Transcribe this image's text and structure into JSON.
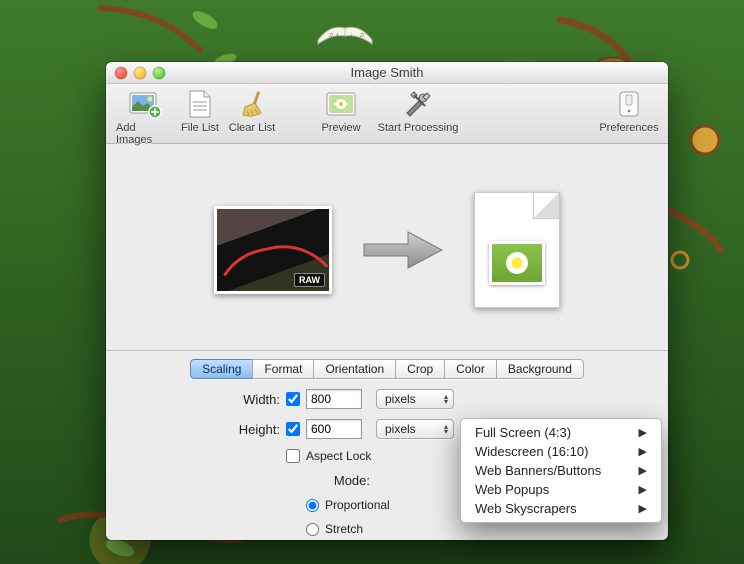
{
  "window": {
    "title": "Image Smith"
  },
  "toolbar": {
    "add_images": "Add Images",
    "file_list": "File List",
    "clear_list": "Clear List",
    "preview": "Preview",
    "start_processing": "Start Processing",
    "preferences": "Preferences"
  },
  "sample": {
    "raw_tag": "RAW"
  },
  "tabs": {
    "scaling": "Scaling",
    "format": "Format",
    "orientation": "Orientation",
    "crop": "Crop",
    "color": "Color",
    "background": "Background"
  },
  "form": {
    "width_label": "Width:",
    "height_label": "Height:",
    "width_value": "800",
    "height_value": "600",
    "units_width": "pixels",
    "units_height": "pixels",
    "aspect_lock": "Aspect Lock",
    "mode_label": "Mode:",
    "proportional": "Proportional",
    "stretch": "Stretch"
  },
  "preset_menu": {
    "items": [
      "Full Screen (4:3)",
      "Widescreen (16:10)",
      "Web Banners/Buttons",
      "Web Popups",
      "Web Skyscrapers"
    ]
  }
}
